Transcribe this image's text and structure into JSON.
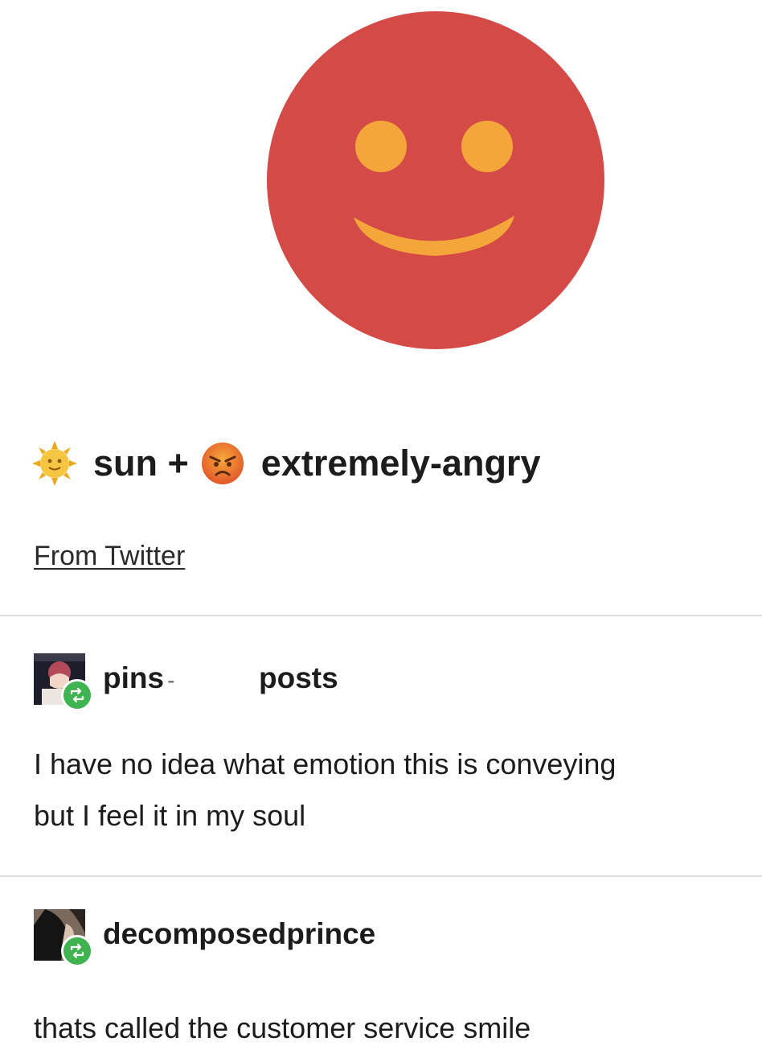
{
  "emoji_mix": {
    "image_name": "smiling-red-face-emoji",
    "face_color": "#d44a47",
    "feature_color": "#f4a63a",
    "left_emoji_icon": "sun-with-face-icon",
    "left_label": "sun +",
    "right_emoji_icon": "extremely-angry-face-icon",
    "right_label": "extremely-angry",
    "source_link": "From Twitter"
  },
  "reblogs": [
    {
      "username": "pins",
      "username_separator": "-",
      "username_suffix": "posts",
      "avatar_icon": "anime-character-avatar-icon",
      "badge_icon": "reblog-icon",
      "body_line1": "I have no idea what emotion this is conveying",
      "body_line2": "but I feel it in my soul"
    },
    {
      "username": "decomposedprince",
      "avatar_icon": "dark-hair-portrait-avatar-icon",
      "badge_icon": "reblog-icon",
      "body_line1": "thats called the customer service smile"
    }
  ],
  "colors": {
    "reblog_badge": "#3fb34f",
    "divider": "#dcdcdc"
  }
}
